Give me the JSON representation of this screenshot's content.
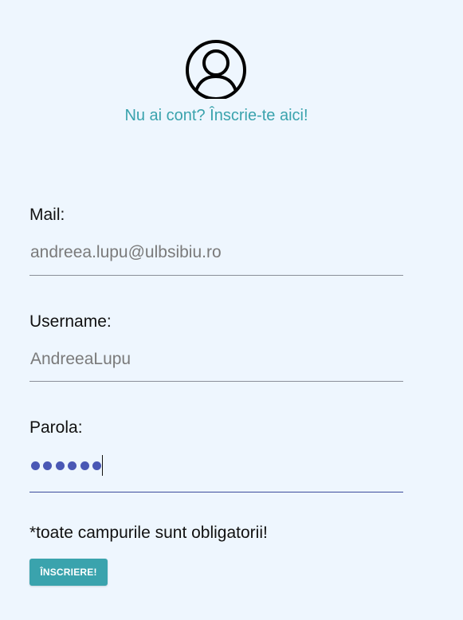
{
  "header": {
    "avatar_icon": "user-circle-icon",
    "signup_prompt": "Nu ai cont? Înscrie-te aici!"
  },
  "form": {
    "mail": {
      "label": "Mail:",
      "value": "andreea.lupu@ulbsibiu.ro"
    },
    "username": {
      "label": "Username:",
      "value": "AndreeaLupu"
    },
    "password": {
      "label": "Parola:",
      "masked_length": 6
    },
    "required_note": "*toate campurile sunt obligatorii!",
    "submit_label": "ÎNSCRIERE!"
  },
  "colors": {
    "background": "#eef6fe",
    "accent": "#3aa3ad",
    "active_underline": "#3b4a9a",
    "password_dot": "#4a58b5"
  }
}
